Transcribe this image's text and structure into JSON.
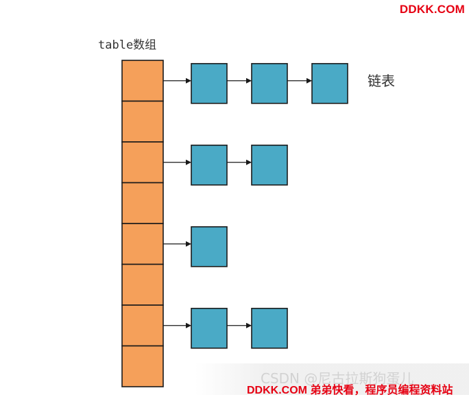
{
  "watermark_top": "DDKK.COM",
  "table_label": "table数组",
  "list_label": "链表",
  "watermark_csdn": "CSDN @尼古拉斯狗蛋儿",
  "watermark_bottom": "DDKK.COM 弟弟快看，程序员编程资料站",
  "colors": {
    "array_cell": "#f5a05a",
    "list_node": "#4aaac6",
    "stroke": "#1a1a1a",
    "watermark": "#e60012"
  },
  "array": {
    "slot_count": 8
  },
  "chains": [
    {
      "slot": 0,
      "node_count": 3
    },
    {
      "slot": 2,
      "node_count": 2
    },
    {
      "slot": 4,
      "node_count": 1
    },
    {
      "slot": 6,
      "node_count": 2
    }
  ]
}
